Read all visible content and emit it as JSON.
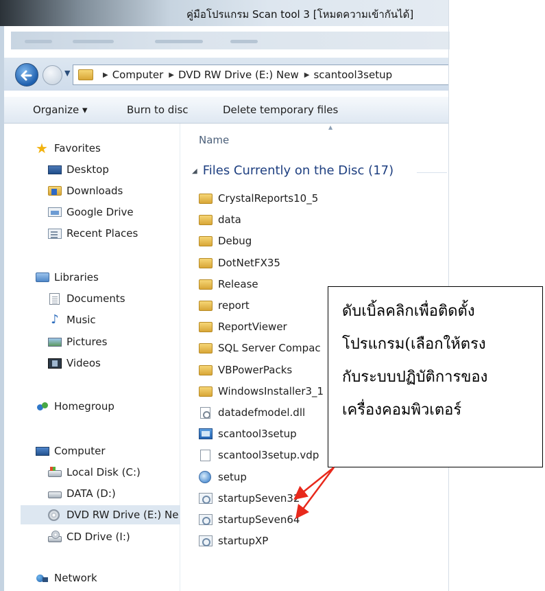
{
  "window": {
    "title": "คู่มือโปรแกรม Scan tool 3 [โหมดความเข้ากันได้]"
  },
  "address_bar": {
    "crumbs": [
      "Computer",
      "DVD RW Drive (E:) New",
      "scantool3setup"
    ]
  },
  "toolbar": {
    "organize": "Organize ▾",
    "burn": "Burn to disc",
    "delete_temp": "Delete temporary files"
  },
  "nav": {
    "favorites": "Favorites",
    "desktop": "Desktop",
    "downloads": "Downloads",
    "google_drive": "Google Drive",
    "recent_places": "Recent Places",
    "libraries": "Libraries",
    "documents": "Documents",
    "music": "Music",
    "pictures": "Pictures",
    "videos": "Videos",
    "homegroup": "Homegroup",
    "computer": "Computer",
    "local_disk": "Local Disk (C:)",
    "data_drive": "DATA (D:)",
    "dvd_drive": "DVD RW Drive (E:) Ne",
    "cd_drive": "CD Drive (I:)",
    "network": "Network"
  },
  "file_list": {
    "column_name": "Name",
    "group_header": "Files Currently on the Disc (17)",
    "files": [
      {
        "name": "CrystalReports10_5",
        "icon": "folder-icon"
      },
      {
        "name": "data",
        "icon": "folder-icon"
      },
      {
        "name": "Debug",
        "icon": "folder-icon"
      },
      {
        "name": "DotNetFX35",
        "icon": "folder-icon"
      },
      {
        "name": "Release",
        "icon": "folder-icon"
      },
      {
        "name": "report",
        "icon": "folder-icon"
      },
      {
        "name": "ReportViewer",
        "icon": "folder-icon"
      },
      {
        "name": "SQL Server Compac",
        "icon": "folder-icon"
      },
      {
        "name": "VBPowerPacks",
        "icon": "folder-icon"
      },
      {
        "name": "WindowsInstaller3_1",
        "icon": "folder-icon"
      },
      {
        "name": "datadefmodel.dll",
        "icon": "dll-file-icon"
      },
      {
        "name": "scantool3setup",
        "icon": "installer-icon"
      },
      {
        "name": "scantool3setup.vdp",
        "icon": "blank-file-icon"
      },
      {
        "name": "setup",
        "icon": "setup-icon"
      },
      {
        "name": "startupSeven32",
        "icon": "executable-icon"
      },
      {
        "name": "startupSeven64",
        "icon": "executable-icon"
      },
      {
        "name": "startupXP",
        "icon": "executable-icon"
      }
    ]
  },
  "callout": {
    "lines": [
      "ดับเบิ้ลคลิกเพื่อติดตั้ง",
      "โปรแกรม(เลือกให้ตรง",
      "กับระบบปฏิบัติการของ",
      "เครื่องคอมพิวเตอร์"
    ]
  },
  "colors": {
    "arrow": "#e8291c",
    "group_header": "#1e3f80",
    "selected_row": "#dde7f1"
  }
}
